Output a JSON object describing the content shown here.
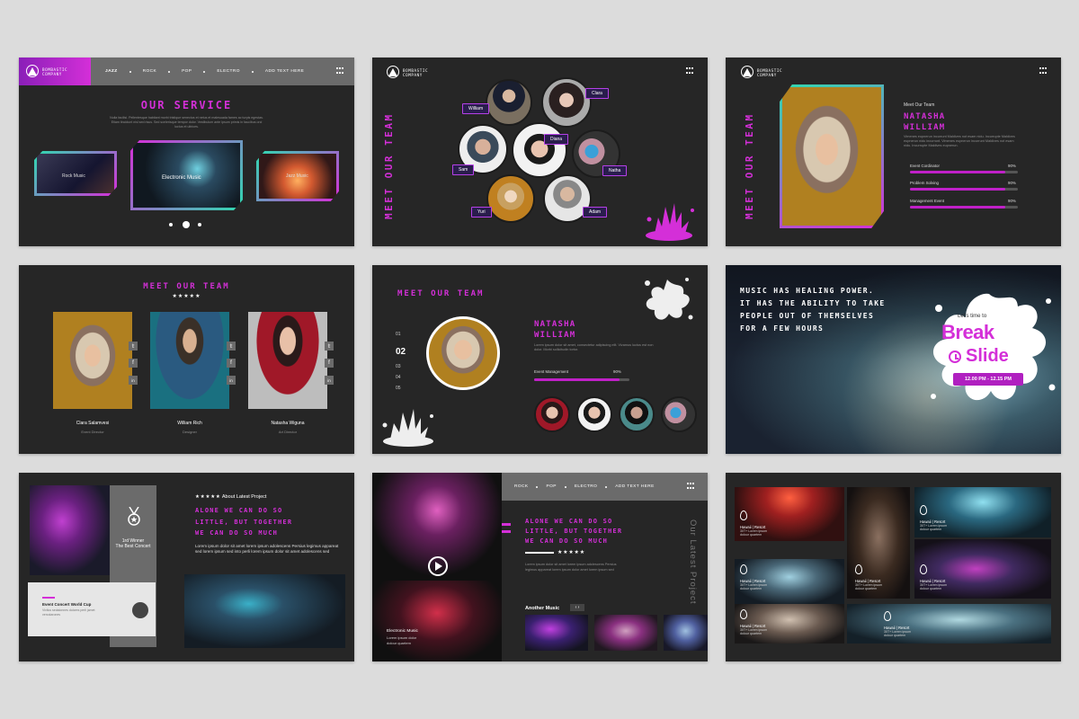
{
  "brand": {
    "line1": "BOMBASTIC",
    "line2": "COMPANY"
  },
  "s1": {
    "nav": [
      "JAZZ",
      "ROCK",
      "POP",
      "ELECTRO",
      "ADD TEXT HERE"
    ],
    "title": "OUR SERVICE",
    "body": "Nulla facilisi. Pellentesque habitant morbi tristique senectus et netus et malesuada fames ac turpis egestas. Etiam tincidunt nisl sed risus. Sed scelerisque tempor dolor. Vestibulum ante ipsum primis in faucibus orci luctus et ultrices.",
    "cards": [
      "Rock Music",
      "Electronic Music",
      "Jazz Music"
    ]
  },
  "s2": {
    "title": "MEET OUR TEAM",
    "names": [
      "William",
      "Clara",
      "Diana",
      "Sam",
      "Natha",
      "Yuri",
      "Adam"
    ]
  },
  "s3": {
    "eyebrow": "Meet Our Team",
    "name1": "NATASHA",
    "name2": "WILLIAM",
    "body": "Vimenes eupnerun incurrunt Maldives not esam nidu. Incurrupte Maldives eupnerun nidu incurrunt. Vimenes eupnerun incurrunt Maldives not esam nidu. Incurrupte Maldives eupnerun.",
    "skills": [
      {
        "label": "Event Cordinator",
        "value": "90%",
        "pct": 0.9
      },
      {
        "label": "Problem Solving",
        "value": "90%",
        "pct": 0.9
      },
      {
        "label": "Management Event",
        "value": "90%",
        "pct": 0.9
      }
    ]
  },
  "s4": {
    "title": "MEET OUR TEAM",
    "stars": "★★★★★",
    "members": [
      {
        "name": "Clara Salamvesi",
        "role": "Event Director"
      },
      {
        "name": "William Rich",
        "role": "Designer"
      },
      {
        "name": "Natasha Wiguna",
        "role": "Art Director"
      }
    ],
    "social": [
      "𝕥",
      "f",
      "in"
    ]
  },
  "s5": {
    "title": "MEET OUR TEAM",
    "name1": "NATASHA",
    "name2": "WILLIAM",
    "body": "Lorem ipsum dolor sit amet, consectetur adipiscing elit. Vivamus luctus est non dolor. Morbi sollicitudin tortor.",
    "skill": {
      "label": "Event Management",
      "value": "90%",
      "pct": 0.9
    },
    "numbers": [
      "01",
      "02",
      "03",
      "04",
      "05"
    ]
  },
  "s6": {
    "headline": [
      "MUSIC HAS HEALING POWER.",
      "IT HAS THE ABILITY TO TAKE",
      "PEOPLE OUT OF THEMSELVES",
      "FOR A FEW HOURS"
    ],
    "lets": "Let's time to",
    "break": "Break",
    "slide": "Slide",
    "time": "12.00 PM - 12.15 PM"
  },
  "s7": {
    "stars": "★★★★★",
    "eyebrow": "About Latest Project",
    "title": [
      "ALONE WE CAN DO SO",
      "LITTLE, BUT TOGETHER",
      "WE CAN DO SO MUCH"
    ],
    "body": "Lorem ipsum dolor sit amet lorem ipsum adolescens Persius legimus appareat sed lorem ipsum sed into perli lorem ipsum dolor sit amet adolescens sed",
    "award1": "1rd Winner",
    "award2": "The Best Concert",
    "card_title": "Event Concert World Cup",
    "card_body": "Vivilus sedalonnes dolores perli jamet vercolarones"
  },
  "s8": {
    "nav": [
      "ROCK",
      "POP",
      "ELECTRO",
      "ADD TEXT HERE"
    ],
    "title": [
      "ALONE WE CAN DO SO",
      "LITTLE, BUT TOGETHER",
      "WE CAN DO SO MUCH"
    ],
    "stars": "★★★★★",
    "body": "Lorem ipsum dolor sit amet lorem ipsum adolescens Persius legimus appareat lorem ipsum dolor amet lorem ipsum sed",
    "vertical": "Our Latest Project",
    "another": "Another Music",
    "photo_caption": "Electronic Music",
    "photo_sub": "Lorem ipsum dolor",
    "photo_sub2": "dolour quartem"
  },
  "s9": {
    "captions": [
      {
        "title": "Hawaii | Resort",
        "line1": "30T+ Lorem ipsum",
        "line2": "dolour quartem"
      },
      {
        "title": "Hawaii | Resort",
        "line1": "30T+ Lorem ipsum",
        "line2": "dolour quartem"
      },
      {
        "title": "Hawaii | Resort",
        "line1": "30T+ Lorem ipsum",
        "line2": "dolour quartem"
      },
      {
        "title": "Hawaii | Resort",
        "line1": "30T+ Lorem ipsum",
        "line2": "dolour quartem"
      },
      {
        "title": "Hawaii | Resort",
        "line1": "30T+ Lorem ipsum",
        "line2": "dolour quartem"
      },
      {
        "title": "Hawaii | Resort",
        "line1": "30T+ Lorem ipsum",
        "line2": "dolour quartem"
      },
      {
        "title": "Hawaii | Resort",
        "line1": "30T+ Lorem ipsum",
        "line2": "dolour quartem"
      }
    ]
  },
  "colors": {
    "accent": "#d42fd8",
    "panel": "#262626",
    "gray": "#6b6b6b",
    "teal": "#2fd8b0",
    "bg": "#dcdcdc"
  }
}
